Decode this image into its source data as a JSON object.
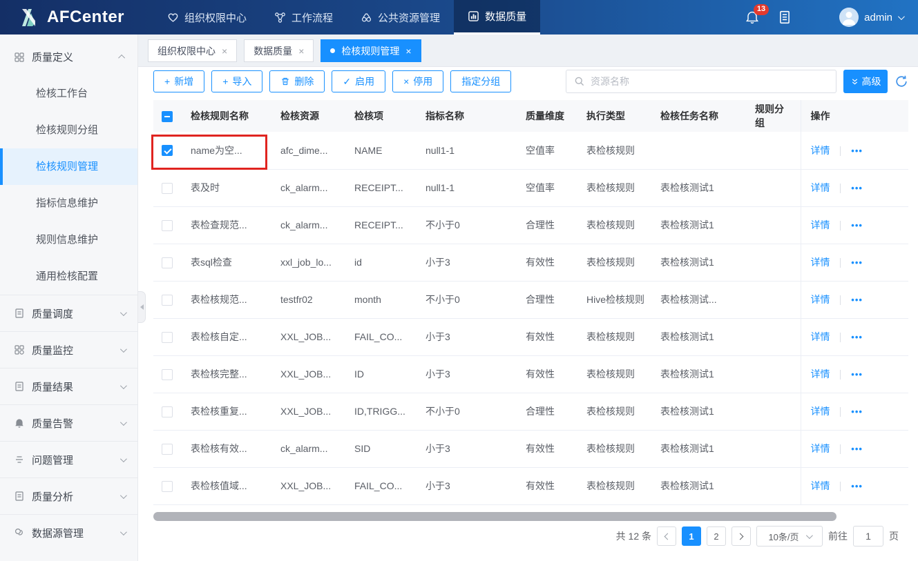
{
  "colors": {
    "primary": "#1890ff",
    "topbar_left": "#142f66",
    "topbar_right": "#2173c4",
    "notification_badge": "#e23a2e",
    "annotation": "#e02420"
  },
  "topbar": {
    "logo_text": "AFCenter",
    "nav": [
      {
        "label": "组织权限中心",
        "icon": "heart-icon"
      },
      {
        "label": "工作流程",
        "icon": "workflow-icon"
      },
      {
        "label": "公共资源管理",
        "icon": "resources-icon"
      },
      {
        "label": "数据质量",
        "icon": "data-quality-icon",
        "active": true
      }
    ],
    "notification_count": "13",
    "user": "admin"
  },
  "sidebar": {
    "groups": [
      {
        "label": "质量定义",
        "icon": "grid-icon",
        "expanded": true
      },
      {
        "label": "质量调度",
        "icon": "document-icon"
      },
      {
        "label": "质量监控",
        "icon": "grid-icon"
      },
      {
        "label": "质量结果",
        "icon": "document-icon"
      },
      {
        "label": "质量告警",
        "icon": "bell-icon"
      },
      {
        "label": "问题管理",
        "icon": "list-icon"
      },
      {
        "label": "质量分析",
        "icon": "document-icon"
      },
      {
        "label": "数据源管理",
        "icon": "database-icon"
      }
    ],
    "sub_items": [
      "检核工作台",
      "检核规则分组",
      "检核规则管理",
      "指标信息维护",
      "规则信息维护",
      "通用检核配置"
    ],
    "active_sub": "检核规则管理"
  },
  "tabs": [
    {
      "label": "组织权限中心"
    },
    {
      "label": "数据质量"
    },
    {
      "label": "检核规则管理",
      "active": true
    }
  ],
  "toolbar": {
    "buttons": [
      {
        "label": "新增",
        "icon": "plus-icon"
      },
      {
        "label": "导入",
        "icon": "plus-icon"
      },
      {
        "label": "删除",
        "icon": "trash-icon"
      },
      {
        "label": "启用",
        "icon": "check-icon"
      },
      {
        "label": "停用",
        "icon": "close-icon"
      },
      {
        "label": "指定分组"
      }
    ],
    "search_placeholder": "资源名称",
    "advanced_label": "高级"
  },
  "table": {
    "columns": [
      "检核规则名称",
      "检核资源",
      "检核项",
      "指标名称",
      "质量维度",
      "执行类型",
      "检核任务名称",
      "规则分组",
      "操作"
    ],
    "action_label": "详情",
    "rows": [
      {
        "checked": true,
        "name": "name为空...",
        "resource": "afc_dime...",
        "item": "NAME",
        "metric": "null1-1",
        "dimension": "空值率",
        "exec_type": "表检核规则",
        "task": "",
        "group": ""
      },
      {
        "checked": false,
        "name": "表及时",
        "resource": "ck_alarm...",
        "item": "RECEIPT...",
        "metric": "null1-1",
        "dimension": "空值率",
        "exec_type": "表检核规则",
        "task": "表检核测试1",
        "group": ""
      },
      {
        "checked": false,
        "name": "表检查规范...",
        "resource": "ck_alarm...",
        "item": "RECEIPT...",
        "metric": "不小于0",
        "dimension": "合理性",
        "exec_type": "表检核规则",
        "task": "表检核测试1",
        "group": ""
      },
      {
        "checked": false,
        "name": "表sql检查",
        "resource": "xxl_job_lo...",
        "item": "id",
        "metric": "小于3",
        "dimension": "有效性",
        "exec_type": "表检核规则",
        "task": "表检核测试1",
        "group": ""
      },
      {
        "checked": false,
        "name": "表检核规范...",
        "resource": "testfr02",
        "item": "month",
        "metric": "不小于0",
        "dimension": "合理性",
        "exec_type": "Hive检核规则",
        "task": "表检核测试...",
        "group": ""
      },
      {
        "checked": false,
        "name": "表检核自定...",
        "resource": "XXL_JOB...",
        "item": "FAIL_CO...",
        "metric": "小于3",
        "dimension": "有效性",
        "exec_type": "表检核规则",
        "task": "表检核测试1",
        "group": ""
      },
      {
        "checked": false,
        "name": "表检核完整...",
        "resource": "XXL_JOB...",
        "item": "ID",
        "metric": "小于3",
        "dimension": "有效性",
        "exec_type": "表检核规则",
        "task": "表检核测试1",
        "group": ""
      },
      {
        "checked": false,
        "name": "表检核重复...",
        "resource": "XXL_JOB...",
        "item": "ID,TRIGG...",
        "metric": "不小于0",
        "dimension": "合理性",
        "exec_type": "表检核规则",
        "task": "表检核测试1",
        "group": ""
      },
      {
        "checked": false,
        "name": "表检核有效...",
        "resource": "ck_alarm...",
        "item": "SID",
        "metric": "小于3",
        "dimension": "有效性",
        "exec_type": "表检核规则",
        "task": "表检核测试1",
        "group": ""
      },
      {
        "checked": false,
        "name": "表检核值域...",
        "resource": "XXL_JOB...",
        "item": "FAIL_CO...",
        "metric": "小于3",
        "dimension": "有效性",
        "exec_type": "表检核规则",
        "task": "表检核测试1",
        "group": ""
      }
    ]
  },
  "pagination": {
    "total": "共 12 条",
    "pages": [
      "1",
      "2"
    ],
    "active_page": "1",
    "page_size": "10条/页",
    "goto_label": "前往",
    "goto_value": "1",
    "page_suffix": "页"
  }
}
